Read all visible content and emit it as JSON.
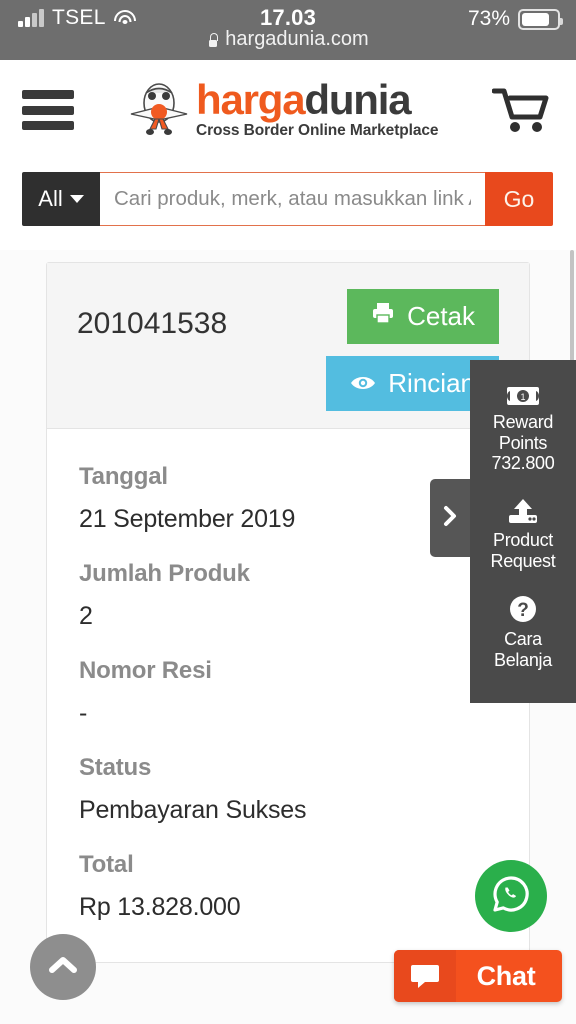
{
  "statusbar": {
    "carrier": "TSEL",
    "time": "17.03",
    "battery_percent": "73%",
    "url": "hargadunia.com",
    "signal_icon": "signal-bars-icon",
    "wifi_icon": "wifi-icon",
    "lock_icon": "lock-icon",
    "battery_icon": "battery-icon"
  },
  "header": {
    "menu_icon": "hamburger-menu-icon",
    "cart_icon": "shopping-cart-icon",
    "mascot_icon": "airplane-mascot-icon",
    "brand_part1": "harga",
    "brand_part2": "dunia",
    "tagline": "Cross Border Online Marketplace",
    "brand_color": "#ef5a1e",
    "brand_dark": "#3b3b3b"
  },
  "search": {
    "category_label": "All",
    "category_caret_icon": "chevron-down-icon",
    "placeholder": "Cari produk, merk, atau masukkan link A",
    "value": "",
    "go_label": "Go",
    "go_color": "#e8491d"
  },
  "order": {
    "order_number": "201041538",
    "print_label": "Cetak",
    "print_icon": "printer-icon",
    "print_color": "#5cb85c",
    "detail_label": "Rincian",
    "detail_icon": "eye-icon",
    "detail_color": "#53bde0",
    "fields": [
      {
        "label": "Tanggal",
        "value": "21 September 2019"
      },
      {
        "label": "Jumlah Produk",
        "value": "2"
      },
      {
        "label": "Nomor Resi",
        "value": "-"
      },
      {
        "label": "Status",
        "value": "Pembayaran Sukses"
      },
      {
        "label": "Total",
        "value": "Rp 13.828.000"
      }
    ]
  },
  "side_panel": {
    "toggle_icon": "chevron-right-icon",
    "items": [
      {
        "icon": "banknote-icon",
        "line1": "Reward",
        "line2": "Points",
        "line3": "732.800"
      },
      {
        "icon": "upload-icon",
        "line1": "Product",
        "line2": "Request",
        "line3": ""
      },
      {
        "icon": "question-mark-icon",
        "line1": "Cara Belanja",
        "line2": "",
        "line3": ""
      }
    ],
    "background": "#4a4a4a"
  },
  "floating": {
    "scroll_top_icon": "chevron-up-icon",
    "whatsapp_icon": "whatsapp-icon",
    "whatsapp_color": "#2aaf4b",
    "chat_label": "Chat",
    "chat_icon": "speech-bubble-icon",
    "chat_color": "#f4511e"
  }
}
